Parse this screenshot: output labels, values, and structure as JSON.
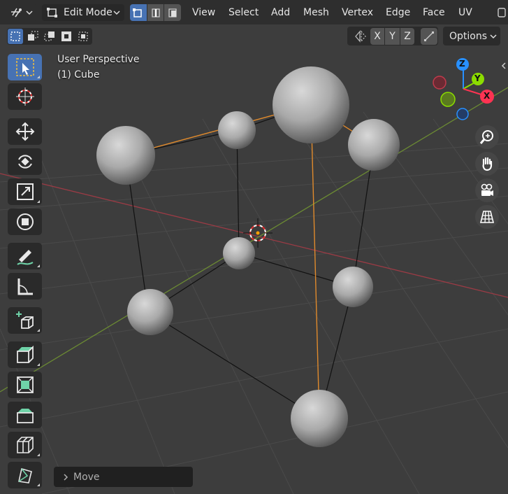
{
  "header": {
    "mode_label": "Edit Mode",
    "menus": [
      "View",
      "Select",
      "Add",
      "Mesh",
      "Vertex",
      "Edge",
      "Face",
      "UV"
    ]
  },
  "toolbar2": {
    "axis_x": "X",
    "axis_y": "Y",
    "axis_z": "Z",
    "options_label": "Options"
  },
  "viewport": {
    "view_name": "User Perspective",
    "object_name": "(1) Cube"
  },
  "gizmo": {
    "x_label": "X",
    "y_label": "Y",
    "z_label": "Z"
  },
  "last_operator": {
    "label": "Move"
  },
  "colors": {
    "x_axis": "#ff3352",
    "y_axis": "#8bdc00",
    "z_axis": "#2890ff",
    "active_blue": "#4772b3",
    "selection_orange": "#ffa000"
  }
}
